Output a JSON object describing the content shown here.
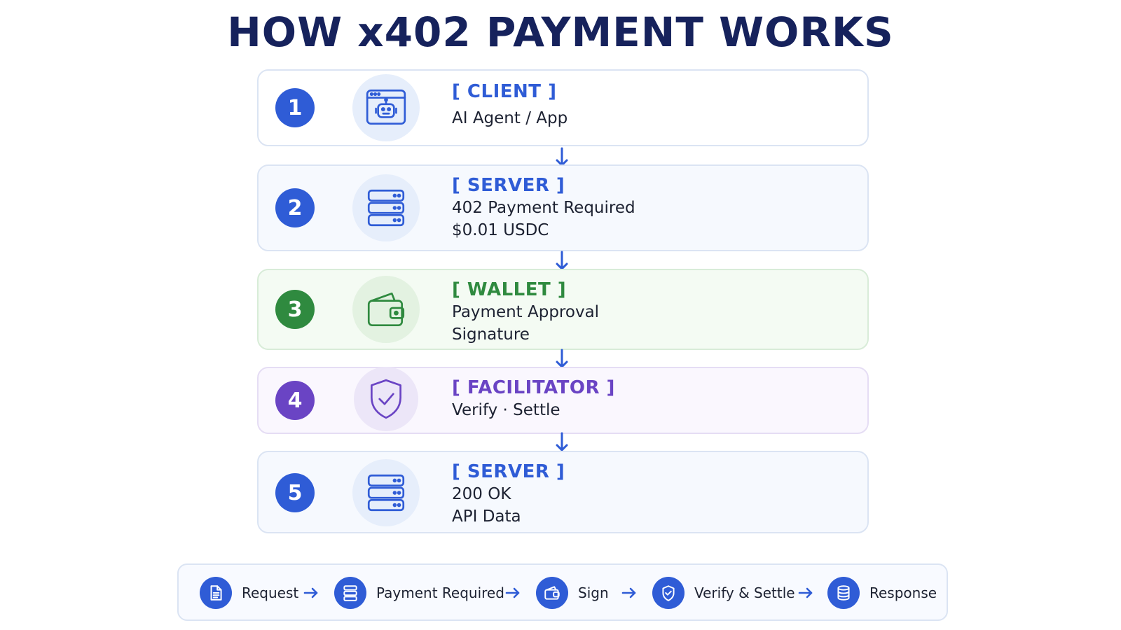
{
  "title": "HOW x402 PAYMENT WORKS",
  "colors": {
    "title": "#16225c",
    "blue": "#2f5cd6",
    "green": "#2f8a3f",
    "purple": "#6a44c4",
    "arrow": "#2f5cd6"
  },
  "steps": [
    {
      "number": "1",
      "heading": "[ CLIENT ]",
      "lines": [
        "AI Agent / App"
      ],
      "icon": "robot-browser-icon",
      "tone": "blue"
    },
    {
      "number": "2",
      "heading": "[ SERVER ]",
      "lines": [
        "402 Payment Required",
        "$0.01 USDC"
      ],
      "icon": "server-icon",
      "tone": "blue"
    },
    {
      "number": "3",
      "heading": "[ WALLET ]",
      "lines": [
        "Payment Approval",
        "Signature"
      ],
      "icon": "wallet-icon",
      "tone": "green"
    },
    {
      "number": "4",
      "heading": "[ FACILITATOR ]",
      "lines": [
        "Verify · Settle"
      ],
      "icon": "shield-check-icon",
      "tone": "purple"
    },
    {
      "number": "5",
      "heading": "[ SERVER ]",
      "lines": [
        "200 OK",
        "API Data"
      ],
      "icon": "server-icon",
      "tone": "blue"
    }
  ],
  "legend": [
    {
      "label": "Request",
      "icon": "document-icon"
    },
    {
      "label": "Payment Required",
      "icon": "server-icon"
    },
    {
      "label": "Sign",
      "icon": "wallet-icon"
    },
    {
      "label": "Verify & Settle",
      "icon": "shield-check-icon"
    },
    {
      "label": "Response",
      "icon": "database-icon"
    }
  ]
}
